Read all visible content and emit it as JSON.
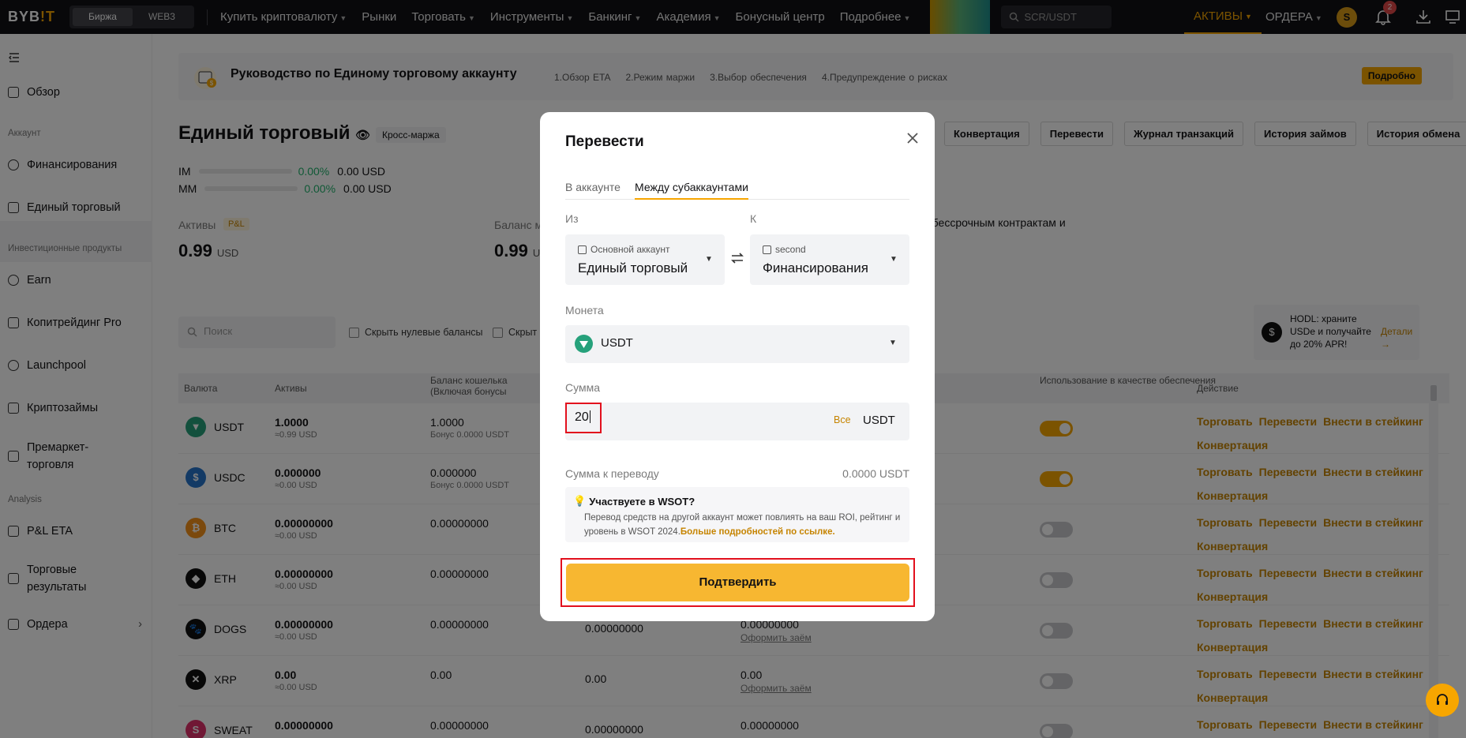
{
  "topbar": {
    "logo_a": "BYB",
    "logo_b": "!T",
    "switch": [
      "Биржа",
      "WEB3"
    ],
    "nav": [
      "Купить криптовалюту",
      "Рынки",
      "Торговать",
      "Инструменты",
      "Банкинг",
      "Академия",
      "Бонусный центр",
      "Подробнее"
    ],
    "search_placeholder": "SCR/USDT",
    "assets": "АКТИВЫ",
    "orders": "ОРДЕРА",
    "avatar_letter": "S",
    "notifications": "2"
  },
  "sidebar": {
    "overview": "Обзор",
    "section_account": "Аккаунт",
    "funding": "Финансирования",
    "unified": "Единый торговый",
    "section_invest": "Инвестиционные продукты",
    "earn": "Earn",
    "copy": "Копитрейдинг Pro",
    "launchpool": "Launchpool",
    "loans": "Криптозаймы",
    "premarket": "Премаркет-торговля",
    "section_analysis": "Analysis",
    "pnl": "P&L ETA",
    "results": "Торговые результаты",
    "orders": "Ордера"
  },
  "guide": {
    "title": "Руководство по Единому торговому аккаунту",
    "steps": [
      "1.Обзор ETA",
      "2.Режим маржи",
      "3.Выбор обеспечения",
      "4.Предупреждение о рисках"
    ],
    "button": "Подробно"
  },
  "account": {
    "title": "Единый торговый",
    "margin_mode": "Кросс-маржа",
    "im_label": "IM",
    "im_pct": "0.00%",
    "im_val": "0.00 USD",
    "mm_label": "MM",
    "mm_pct": "0.00%",
    "mm_val": "0.00 USD",
    "assets_label": "Активы",
    "pnl_tag": "P&L",
    "assets_val": "0.99",
    "assets_unit": "USD",
    "wallet_label": "Баланс м",
    "wallet_val": "0.99",
    "wallet_unit": "U",
    "perp_note": "о бессрочным контрактам и",
    "buttons": [
      "Конвертация",
      "Перевести",
      "Журнал транзакций",
      "История займов",
      "История обмена"
    ]
  },
  "filters": {
    "search_placeholder": "Поиск",
    "hide_zero": "Скрыть нулевые балансы",
    "hide_small": "Скрыт"
  },
  "hodl": {
    "text": "HODL: храните USDe и получайте до 20% APR!",
    "link": "Детали"
  },
  "table": {
    "headers": [
      "Валюта",
      "Активы",
      "Баланс кошелька (Включая бонусы",
      "Использование в качестве обеспечения",
      "Действие"
    ],
    "rows": [
      {
        "coin": "USDT",
        "amount": "1.0000",
        "usd": "≈0.99 USD",
        "bal": "1.0000",
        "bonus": "Бонус 0.0000 USDT",
        "c3": "",
        "c4": "",
        "c4link": "",
        "toggle": true
      },
      {
        "coin": "USDC",
        "amount": "0.000000",
        "usd": "≈0.00 USD",
        "bal": "0.000000",
        "bonus": "Бонус 0.0000 USDT",
        "c3": "",
        "c4": "",
        "c4link": "",
        "toggle": true
      },
      {
        "coin": "BTC",
        "amount": "0.00000000",
        "usd": "≈0.00 USD",
        "bal": "0.00000000",
        "bonus": "",
        "c3": "",
        "c4": "",
        "c4link": "",
        "toggle": false
      },
      {
        "coin": "ETH",
        "amount": "0.00000000",
        "usd": "≈0.00 USD",
        "bal": "0.00000000",
        "bonus": "",
        "c3": "",
        "c4": "",
        "c4link": "",
        "toggle": false
      },
      {
        "coin": "DOGS",
        "amount": "0.00000000",
        "usd": "≈0.00 USD",
        "bal": "0.00000000",
        "bonus": "",
        "c3": "0.00000000",
        "c4": "0.00000000",
        "c4link": "Оформить заём",
        "toggle": false
      },
      {
        "coin": "XRP",
        "amount": "0.00",
        "usd": "≈0.00 USD",
        "bal": "0.00",
        "bonus": "",
        "c3": "0.00",
        "c4": "0.00",
        "c4link": "Оформить заём",
        "toggle": false
      },
      {
        "coin": "SWEAT",
        "amount": "0.00000000",
        "usd": "",
        "bal": "0.00000000",
        "bonus": "",
        "c3": "0.00000000",
        "c4": "0.00000000",
        "c4link": "",
        "toggle": false
      }
    ],
    "actions": {
      "trade": "Торговать",
      "transfer": "Перевести",
      "stake": "Внести в стейкинг",
      "convert": "Конвертация"
    }
  },
  "modal": {
    "title": "Перевести",
    "tab_in": "В аккаунте",
    "tab_between": "Между субаккаунтами",
    "from_label": "Из",
    "to_label": "К",
    "from_sub": "Основной аккаунт",
    "from_main": "Единый торговый",
    "to_sub": "second",
    "to_main": "Финансирования",
    "coin_label": "Монета",
    "coin": "USDT",
    "amount_label": "Сумма",
    "amount_value": "20",
    "all": "Все",
    "unit": "USDT",
    "transfer_label": "Сумма к переводу",
    "transfer_value": "0.0000 USDT",
    "note_title": "Участвуете в WSOT?",
    "note_text": "Перевод средств на другой аккаунт может повлиять на ваш ROI, рейтинг и уровень в WSOT 2024.",
    "note_link": "Больше подробностей по ссылке.",
    "confirm": "Подтвердить"
  },
  "colors": {
    "accent": "#f7a600",
    "positive": "#20b26c",
    "highlight": "#e2101d"
  }
}
